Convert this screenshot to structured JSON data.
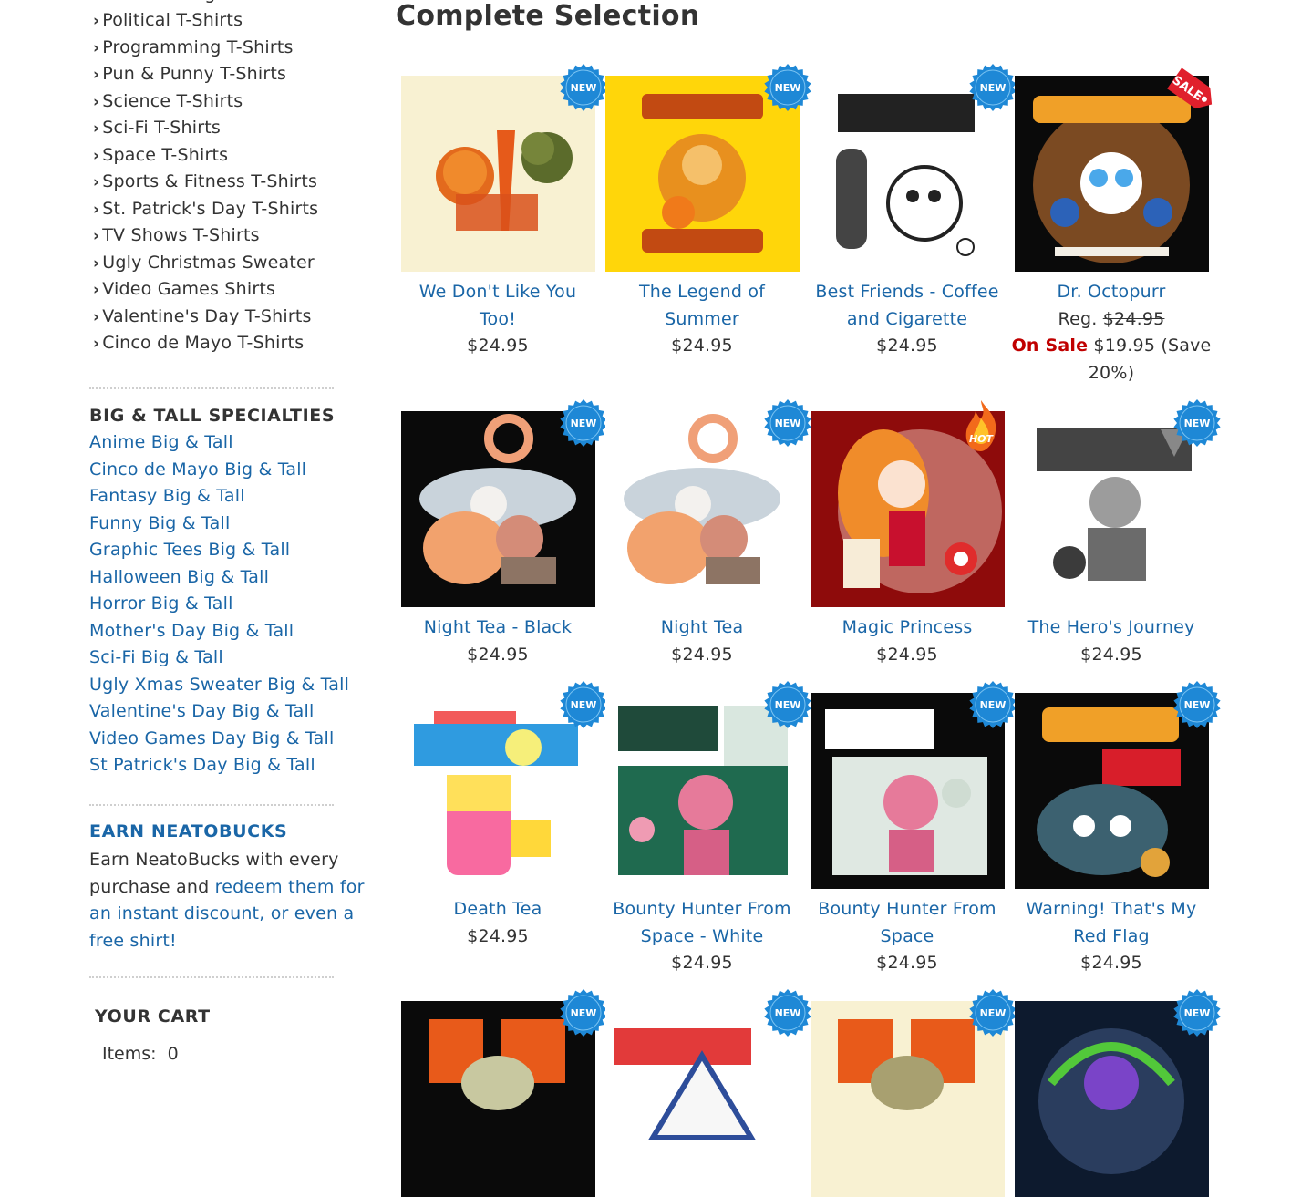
{
  "sidebar": {
    "categories": [
      "Political T-Shirts",
      "Programming T-Shirts",
      "Pun & Punny T-Shirts",
      "Science T-Shirts",
      "Sci-Fi T-Shirts",
      "Space T-Shirts",
      "Sports & Fitness T-Shirts",
      "St. Patrick's Day T-Shirts",
      "TV Shows T-Shirts",
      "Ugly Christmas Sweater",
      "Video Games Shirts",
      "Valentine's Day T-Shirts",
      "Cinco de Mayo T-Shirts"
    ],
    "big_tall": {
      "heading": "BIG & TALL SPECIALTIES",
      "links": [
        "Anime Big & Tall",
        "Cinco de Mayo Big & Tall",
        "Fantasy Big & Tall",
        "Funny Big & Tall",
        "Graphic Tees Big & Tall",
        "Halloween Big & Tall",
        "Horror Big & Tall",
        "Mother's Day Big & Tall",
        "Sci-Fi Big & Tall",
        "Ugly Xmas Sweater Big & Tall",
        "Valentine's Day Big & Tall",
        "Video Games Day Big & Tall",
        "St Patrick's Day Big & Tall"
      ]
    },
    "earn": {
      "heading": "EARN NEATOBUCKS",
      "text_before": "Earn NeatoBucks with every purchase and ",
      "link_text": "redeem them for an instant discount, or even a free shirt!"
    },
    "cart": {
      "heading": "YOUR CART",
      "items_label": "Items:",
      "items_count": "0"
    }
  },
  "main": {
    "title": "Complete Selection",
    "badge_new": "NEW",
    "badge_sale": "SALE",
    "badge_hot": "HOT",
    "products": [
      {
        "name": "We Don't Like You Too!",
        "price": "$24.95",
        "badge": "new",
        "bg": "#f8f1d2",
        "art": "veggies"
      },
      {
        "name": "The Legend of Summer",
        "price": "$24.95",
        "badge": "new",
        "bg": "#ffd60a",
        "art": "summer"
      },
      {
        "name": "Best Friends - Coffee and Cigarette",
        "price": "$24.95",
        "badge": "new",
        "bg": "#ffffff",
        "art": "best"
      },
      {
        "name": "Dr. Octopurr",
        "price": "",
        "badge": "sale",
        "bg": "#0a0a0a",
        "art": "octopurr",
        "reg_label": "Reg.",
        "reg_price": "$24.95",
        "sale_label": "On Sale",
        "sale_price": "$19.95",
        "save_text": "(Save 20%)"
      },
      {
        "name": "Night Tea - Black",
        "price": "$24.95",
        "badge": "new",
        "bg": "#0a0a0a",
        "art": "nighttea"
      },
      {
        "name": "Night Tea",
        "price": "$24.95",
        "badge": "new",
        "bg": "#ffffff",
        "art": "nighttea"
      },
      {
        "name": "Magic Princess",
        "price": "$24.95",
        "badge": "hot",
        "bg": "#8e0b0b",
        "art": "princess"
      },
      {
        "name": "The Hero's Journey",
        "price": "$24.95",
        "badge": "new",
        "bg": "#ffffff",
        "art": "hero"
      },
      {
        "name": "Death Tea",
        "price": "$24.95",
        "badge": "new",
        "bg": "#ffffff",
        "art": "deathtea"
      },
      {
        "name": "Bounty Hunter From Space - White",
        "price": "$24.95",
        "badge": "new",
        "bg": "#ffffff",
        "art": "bounty-white"
      },
      {
        "name": "Bounty Hunter From Space",
        "price": "$24.95",
        "badge": "new",
        "bg": "#0a0a0a",
        "art": "bounty-black"
      },
      {
        "name": "Warning! That's My Red Flag",
        "price": "$24.95",
        "badge": "new",
        "bg": "#0a0a0a",
        "art": "redflag"
      },
      {
        "name": "",
        "price": "",
        "badge": "new",
        "bg": "#0a0a0a",
        "art": "sushi-black"
      },
      {
        "name": "",
        "price": "",
        "badge": "new",
        "bg": "#ffffff",
        "art": "onigiri"
      },
      {
        "name": "",
        "price": "",
        "badge": "new",
        "bg": "#f8f1d2",
        "art": "sushi-cream"
      },
      {
        "name": "",
        "price": "",
        "badge": "new",
        "bg": "#0d1a2e",
        "art": "mecha"
      }
    ]
  },
  "colors": {
    "link": "#1a66a7",
    "text": "#333333",
    "sale": "#c00000",
    "badge_new": "#1e88d6",
    "badge_sale": "#e0202c"
  }
}
